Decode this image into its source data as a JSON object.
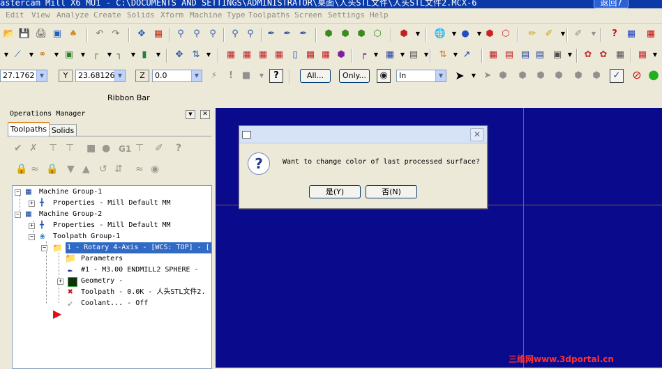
{
  "window": {
    "title": "astercam Mill X6 MU1 - C:\\DOCUMENTS AND SETTINGS\\ADMINISTRATOR\\桌面\\人头STL文件\\人头STL文件2.MCX-6",
    "back_button": "返回7"
  },
  "menubar": [
    "Edit",
    "View",
    "Analyze",
    "Create",
    "Solids",
    "Xform",
    "Machine Type",
    "Toolpaths",
    "Screen",
    "Settings",
    "Help"
  ],
  "coords": {
    "x_value": "27.1762",
    "y_label": "Y",
    "y_value": "23.68126",
    "z_label": "Z",
    "z_value": "0.0",
    "all_button": "All...",
    "only_button": "Only...",
    "unit": "In"
  },
  "ribbon_bar_label": "Ribbon Bar",
  "ops_manager": {
    "title": "Operations Manager",
    "tabs": [
      "Toolpaths",
      "Solids"
    ],
    "toolbar_text": {
      "g1": "G1"
    },
    "tree": [
      {
        "label": "Machine Group-1"
      },
      {
        "label": "Properties - Mill Default MM"
      },
      {
        "label": "Machine Group-2"
      },
      {
        "label": "Properties - Mill Default MM"
      },
      {
        "label": "Toolpath Group-1"
      },
      {
        "label": "1 - Rotary 4-Axis - [WCS: TOP] - ["
      },
      {
        "label": "Parameters"
      },
      {
        "label": "#1 - M3.00 ENDMILL2 SPHERE -"
      },
      {
        "label": "Geometry -"
      },
      {
        "label": "Toolpath - 0.0K - 人头STL文件2."
      },
      {
        "label": "Coolant... - Off"
      }
    ]
  },
  "dialog": {
    "message": "Want to change color of last processed surface?",
    "yes_button": "是(Y)",
    "no_button": "否(N)",
    "close_symbol": "✕"
  },
  "watermark": "三维网www.3dportal.cn",
  "colors": {
    "viewport": "#0a0a8c",
    "crosshair": "#8c5a3c",
    "selection": "#316ac5"
  }
}
